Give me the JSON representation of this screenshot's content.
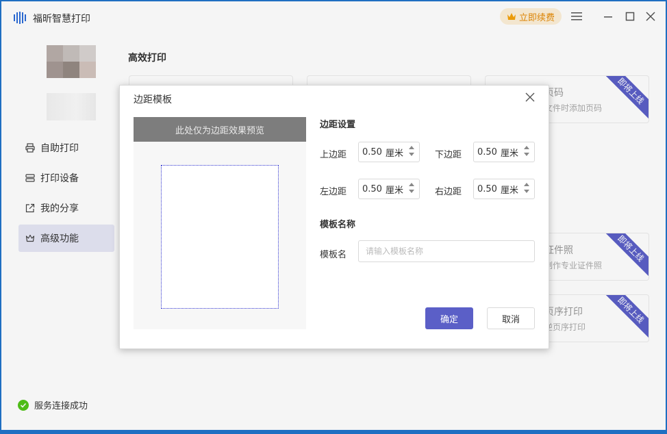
{
  "app": {
    "title": "福昕智慧打印",
    "renew_label": "立即续费",
    "brand_color": "#5b5fc7"
  },
  "sidebar": {
    "items": [
      {
        "label": "自助打印",
        "icon": "printer-icon"
      },
      {
        "label": "打印设备",
        "icon": "device-list-icon"
      },
      {
        "label": "我的分享",
        "icon": "share-icon"
      },
      {
        "label": "高级功能",
        "icon": "crown-outline-icon",
        "active": true
      }
    ],
    "status": "服务连接成功"
  },
  "main": {
    "section_title": "高效打印",
    "cards": [
      {
        "title": "页码",
        "desc": "文件时添加页码",
        "ribbon": "即将上线"
      },
      {
        "title": "证件照",
        "desc": "制作专业证件照",
        "ribbon": "即将上线"
      },
      {
        "title": "页序打印",
        "desc": "逆页序打印",
        "ribbon": "即将上线"
      }
    ]
  },
  "dialog": {
    "title": "边距模板",
    "preview_label": "此处仅为边距效果预览",
    "margin_section": "边距设置",
    "top_label": "上边距",
    "bottom_label": "下边距",
    "left_label": "左边距",
    "right_label": "右边距",
    "top_value": "0.50",
    "bottom_value": "0.50",
    "left_value": "0.50",
    "right_value": "0.50",
    "unit": "厘米",
    "name_section": "模板名称",
    "name_label": "模板名",
    "name_placeholder": "请输入模板名称",
    "ok_label": "确定",
    "cancel_label": "取消"
  }
}
